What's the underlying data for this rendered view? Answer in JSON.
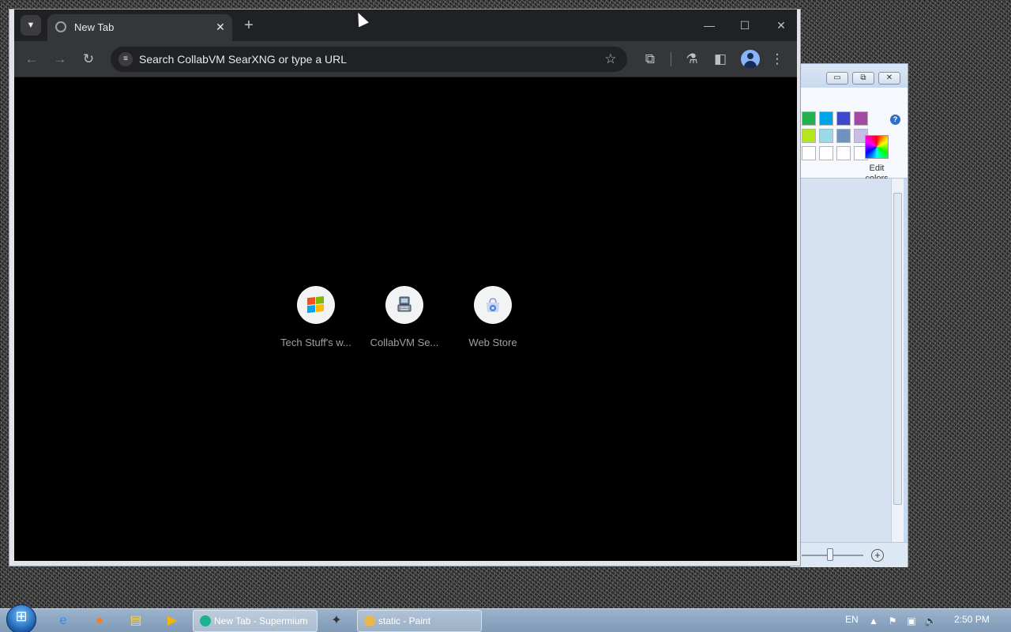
{
  "browser": {
    "tab": {
      "title": "New Tab",
      "close_label": "✕"
    },
    "new_tab_label": "+",
    "window_controls": {
      "minimize": "—",
      "maximize": "☐",
      "close": "✕"
    },
    "toolbar": {
      "back": "←",
      "forward": "→",
      "reload": "↻",
      "omnibox_text": "Search CollabVM SearXNG or type a URL",
      "star": "☆",
      "extensions": "⧉",
      "labs": "⚗",
      "side_panel": "◧",
      "menu": "⋮"
    },
    "shortcuts": [
      {
        "label": "Tech Stuff's w...",
        "icon": "windows-logo-icon"
      },
      {
        "label": "CollabVM Se...",
        "icon": "collabvm-icon"
      },
      {
        "label": "Web Store",
        "icon": "web-store-icon"
      }
    ]
  },
  "paint": {
    "title_buttons": {
      "minimize": "▭",
      "restore": "⧉",
      "close": "✕"
    },
    "help": "?",
    "edit_colors_label": "Edit colors",
    "palette_colors": [
      "#22b14c",
      "#00a2e8",
      "#3f48cc",
      "#a349a4",
      "#b5e61d",
      "#99d9ea",
      "#7092be",
      "#c8bfe7",
      "#ffffff",
      "#ffffff",
      "#ffffff",
      "#ffffff"
    ],
    "zoom_plus": "+"
  },
  "taskbar": {
    "tasks": [
      {
        "label": "New Tab - Supermium",
        "icon_color": "#1bb38f"
      },
      {
        "label": "static - Paint",
        "icon_color": "#e8b84a"
      }
    ],
    "language": "EN",
    "clock": "2:50 PM"
  }
}
